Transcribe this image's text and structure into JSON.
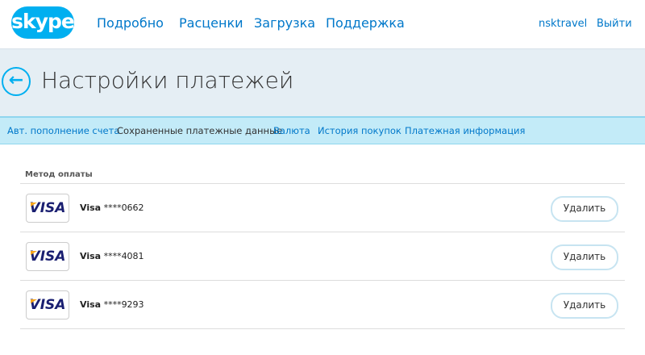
{
  "header": {
    "logo": "skype",
    "nav": [
      "Подробно",
      "Расценки",
      "Загрузка",
      "Поддержка"
    ],
    "user": "nsktravel",
    "logout": "Выйти"
  },
  "page": {
    "title": "Настройки платежей"
  },
  "tabs": [
    "Авт. пополнение счета",
    "Сохраненные платежные данные",
    "Валюта",
    "История покупок",
    "Платежная информация"
  ],
  "section": {
    "header": "Метод оплаты",
    "delete_label": "Удалить",
    "cards": [
      {
        "logo": "VISA",
        "brand": "Visa",
        "number": "****0662"
      },
      {
        "logo": "VISA",
        "brand": "Visa",
        "number": "****4081"
      },
      {
        "logo": "VISA",
        "brand": "Visa",
        "number": "****9293"
      }
    ]
  }
}
